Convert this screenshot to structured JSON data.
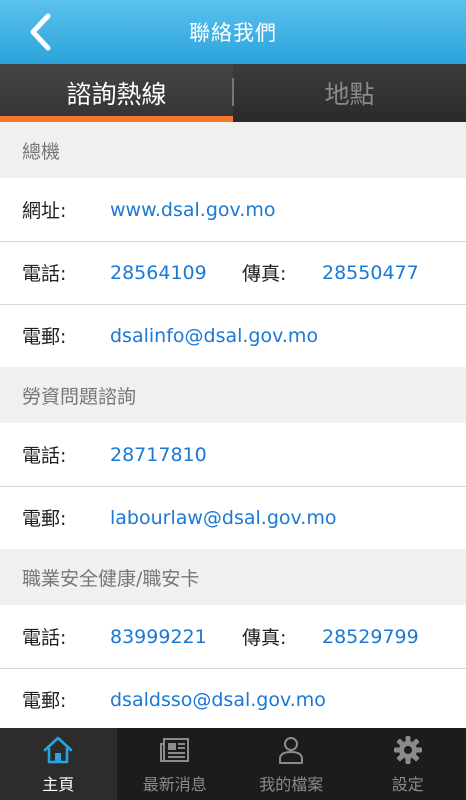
{
  "nav": {
    "title": "聯絡我們"
  },
  "tabs": [
    {
      "label": "諮詢熱線"
    },
    {
      "label": "地點"
    }
  ],
  "sections": [
    {
      "header": "總機",
      "website_label": "網址:",
      "website": "www.dsal.gov.mo",
      "phone_label": "電話:",
      "phone": "28564109",
      "fax_label": "傳真:",
      "fax": "28550477",
      "email_label": "電郵:",
      "email": "dsalinfo@dsal.gov.mo"
    },
    {
      "header": "勞資問題諮詢",
      "phone_label": "電話:",
      "phone": "28717810",
      "email_label": "電郵:",
      "email": "labourlaw@dsal.gov.mo"
    },
    {
      "header": "職業安全健康/職安卡",
      "phone_label": "電話:",
      "phone": "83999221",
      "fax_label": "傳真:",
      "fax": "28529799",
      "email_label": "電郵:",
      "email": "dsaldsso@dsal.gov.mo"
    }
  ],
  "tabbar": [
    {
      "label": "主頁",
      "icon": "home-icon"
    },
    {
      "label": "最新消息",
      "icon": "news-icon"
    },
    {
      "label": "我的檔案",
      "icon": "person-icon"
    },
    {
      "label": "設定",
      "icon": "gear-icon"
    }
  ],
  "colors": {
    "nav_bg": "#2ba3da",
    "accent": "#f4772b",
    "link": "#1a78d6",
    "tabbar_bg": "#1c1c1c"
  }
}
